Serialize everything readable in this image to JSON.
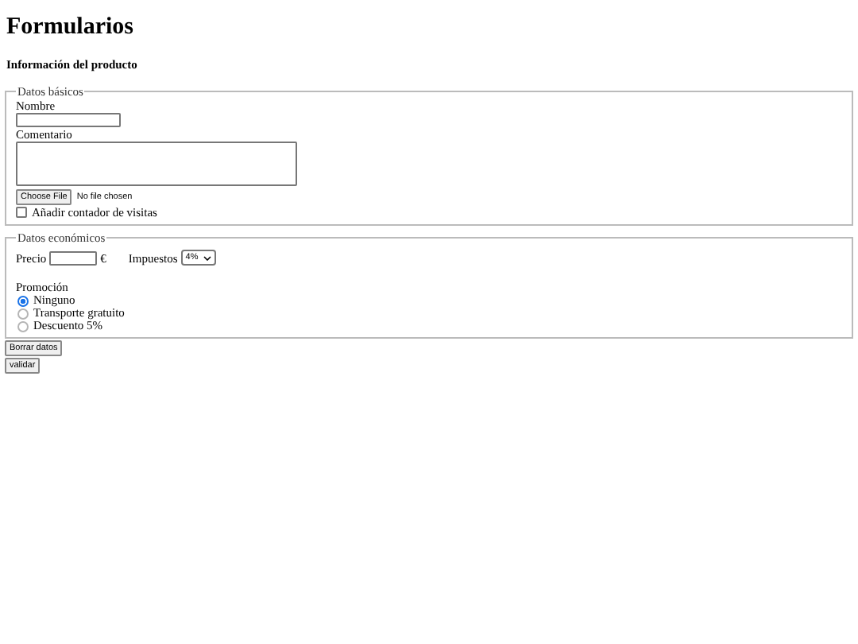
{
  "title": "Formularios",
  "subtitle": "Información del producto",
  "basic": {
    "legend": "Datos básicos",
    "name_label": "Nombre",
    "comment_label": "Comentario",
    "file_button": "Choose File",
    "file_status": "No file chosen",
    "counter": {
      "label": "Añadir contador de visitas",
      "checked": false
    }
  },
  "economic": {
    "legend": "Datos económicos",
    "price_label": "Precio",
    "currency": "€",
    "tax_label": "Impuestos",
    "tax_value": "4%",
    "promo_label": "Promoción",
    "promos": [
      {
        "label": "Ninguno",
        "selected": true
      },
      {
        "label": "Transporte gratuito",
        "selected": false
      },
      {
        "label": "Descuento 5%",
        "selected": false
      }
    ]
  },
  "buttons": [
    "Borrar datos",
    "validar"
  ]
}
